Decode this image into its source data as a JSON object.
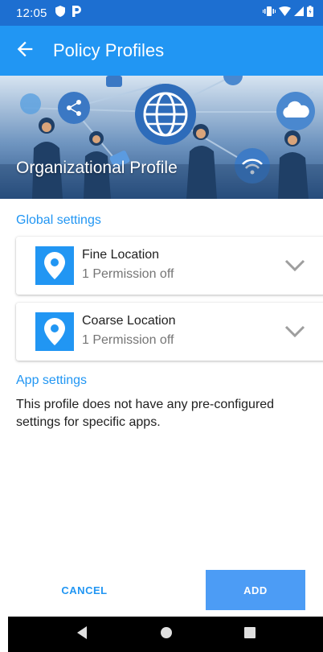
{
  "status_bar": {
    "time": "12:05",
    "icons_left": [
      "shield-icon",
      "p-icon"
    ],
    "icons_right": [
      "vibrate-icon",
      "wifi-icon",
      "signal-icon",
      "battery-icon"
    ]
  },
  "app_bar": {
    "title": "Policy Profiles",
    "back_icon": "arrow-back-icon"
  },
  "banner": {
    "title": "Organizational Profile"
  },
  "global_settings": {
    "label": "Global settings",
    "items": [
      {
        "title": "Fine Location",
        "subtitle": "1 Permission off",
        "icon": "location-pin-icon"
      },
      {
        "title": "Coarse Location",
        "subtitle": "1 Permission off",
        "icon": "location-pin-icon"
      }
    ]
  },
  "app_settings": {
    "label": "App settings",
    "description": "This profile does not have any pre-configured settings for specific apps."
  },
  "actions": {
    "cancel": "CANCEL",
    "add": "ADD"
  },
  "nav_bar": {
    "icons": [
      "back-triangle-icon",
      "home-circle-icon",
      "recents-square-icon"
    ]
  },
  "colors": {
    "primary": "#2196f3",
    "status_bar": "#1d6fd1",
    "add_button": "#4c9cf5"
  }
}
